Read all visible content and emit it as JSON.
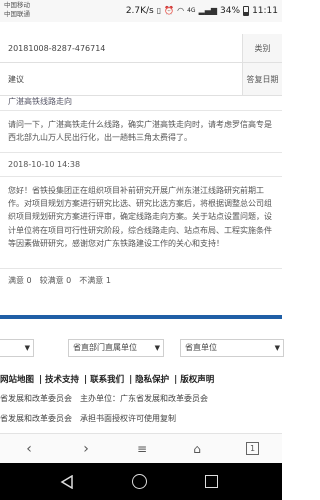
{
  "status": {
    "carrier": "中国移动\n中国联通",
    "speed": "2.7K/s",
    "signal": "4G",
    "battery": "34%",
    "time": "11:11",
    "colors": {
      "bar_bg": "#f7f7f7"
    }
  },
  "record": {
    "id": "20181008-8287-476714",
    "category_label": "类别",
    "type": "建议",
    "reply_date_label": "答复日期",
    "subject": "广湛高铁线路走向",
    "question": "请问一下，广湛高铁走什么线路，确实广湛高铁走向时，请考虑罗信高专是西北部九山万人民出行化，出一趟韩三角太费得了。",
    "reply_date": "2018-10-10 14:38",
    "answer": "您好！省铁投集团正在组织项目补前研究开展广州东湛江线路研究前期工作。对项目规划方案进行研究比选、研究比选方案后，将根据调整总公司组织项目规划研究方案进行评审，确定线路走向方案。关于站点设置问题，设计单位将在项目可行性研究阶段，综合线路走向、站点布局、工程实施条件等因素做研研究，感谢您对广东铁路建设工作的关心和支持！",
    "rating": {
      "satisfied": "满意 0",
      "basic": "较满意 0",
      "unsatisfied": "不满意 1"
    }
  },
  "footer": {
    "selects": [
      "",
      "省直部门直属单位",
      "省直单位"
    ],
    "links": [
      "网站地图",
      "技术支持",
      "联系我们",
      "隐私保护",
      "版权声明"
    ],
    "org_line_1": "省发展和改革委员会　主办单位：广东省发展和改革委员会",
    "org_line_2": "省发展和改革委员会　承担书面授权许可使用复制"
  },
  "browser": {
    "tab_count": "1"
  },
  "colors": {
    "accent": "#1f5fa6",
    "cell_bg": "#f6f6f6"
  }
}
